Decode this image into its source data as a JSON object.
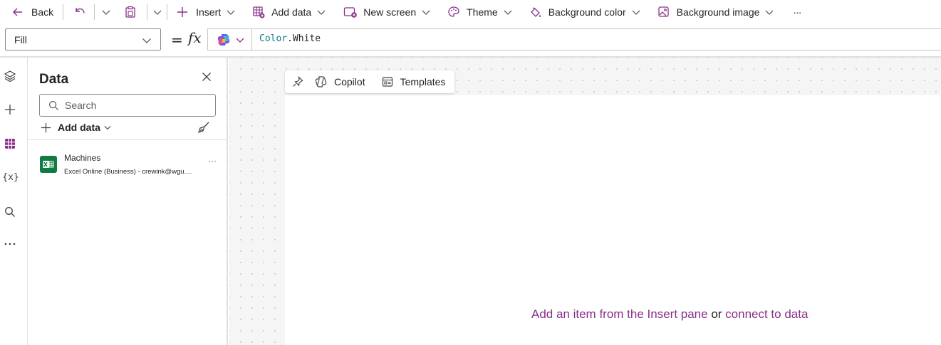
{
  "toolbar": {
    "back_label": "Back",
    "insert_label": "Insert",
    "add_data_label": "Add data",
    "new_screen_label": "New screen",
    "theme_label": "Theme",
    "bg_color_label": "Background color",
    "bg_image_label": "Background image",
    "more_label": "···"
  },
  "formula_bar": {
    "property": "Fill",
    "equals": "=",
    "fx": "fx",
    "formula_object": "Color",
    "formula_dot": ".",
    "formula_property": "White"
  },
  "data_pane": {
    "title": "Data",
    "search_placeholder": "Search",
    "add_data_label": "Add data",
    "items": [
      {
        "name": "Machines",
        "subtitle": "Excel Online (Business) - crewink@wgu....",
        "more": "···"
      }
    ]
  },
  "canvas": {
    "toolbar": {
      "copilot_label": "Copilot",
      "templates_label": "Templates"
    },
    "empty_prefix": "Add an item from the Insert pane",
    "empty_or": " or ",
    "empty_link": "connect to data"
  },
  "colors": {
    "accent": "#8a2f8a",
    "excel_green": "#107c41",
    "formula_object": "#0a7d84"
  }
}
